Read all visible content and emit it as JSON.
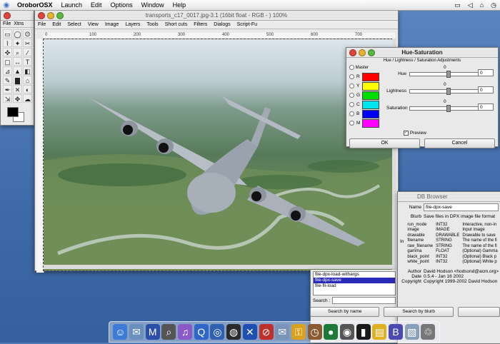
{
  "menubar": {
    "apple": "",
    "items": [
      "OroborOSX",
      "Launch",
      "Edit",
      "Options",
      "Window",
      "Help"
    ],
    "right": [
      "",
      "",
      "",
      ""
    ]
  },
  "toolbox": {
    "menu": [
      "File",
      "Xtns"
    ],
    "tools": [
      "▭",
      "◯",
      "ʘ",
      "⌇",
      "✦",
      "✂",
      "✜",
      "⌕",
      "∕",
      "▢",
      "↔",
      "T",
      "⊿",
      "▲",
      "◧",
      "✎",
      "▇",
      "⌂",
      "✒",
      "✕",
      "◐",
      "⇲",
      "✥",
      "☁"
    ]
  },
  "image_window": {
    "title": "transports_c17_0017.jpg-3.1 (16bit float - RGB - ) 100%",
    "menu": [
      "File",
      "Edit",
      "Select",
      "View",
      "Image",
      "Layers",
      "Tools",
      "Short cuts",
      "Filters",
      "Dialogs",
      "Script-Fu"
    ],
    "ruler_ticks": [
      "0",
      "100",
      "200",
      "300",
      "400",
      "500",
      "600",
      "700"
    ]
  },
  "hue_sat": {
    "title": "Hue-Saturation",
    "subtitle": "Hue / Lightness / Saturation Adjustments",
    "master": "Master",
    "swatches": [
      {
        "label": "R",
        "color": "#ff0000"
      },
      {
        "label": "Y",
        "color": "#ffff00"
      },
      {
        "label": "G",
        "color": "#00dd00"
      },
      {
        "label": "C",
        "color": "#00e5ee"
      },
      {
        "label": "B",
        "color": "#0000ee"
      },
      {
        "label": "M",
        "color": "#ff00ff"
      }
    ],
    "params": [
      {
        "name": "Hue",
        "zero": "0",
        "value": "0"
      },
      {
        "name": "Lightness",
        "zero": "0",
        "value": "0"
      },
      {
        "name": "Saturation",
        "zero": "0",
        "value": "0"
      }
    ],
    "preview": "Preview",
    "ok": "OK",
    "cancel": "Cancel"
  },
  "db_browser": {
    "title": "DB Browser",
    "name_label": "Name",
    "name_value": "file-dpx-save",
    "blurb_label": "Blurb",
    "blurb_value": "Save files in DPX image file format",
    "in_label": "In",
    "params": [
      [
        "run_mode",
        "INT32",
        "Interactive, non-in"
      ],
      [
        "image",
        "IMAGE",
        "Input image"
      ],
      [
        "drawable",
        "DRAWABLE",
        "Drawable to save"
      ],
      [
        "filename",
        "STRING",
        "The name of the fi"
      ],
      [
        "raw_filename",
        "STRING",
        "The name of the fi"
      ],
      [
        "gamma",
        "FLOAT",
        "(Optional) Gamma"
      ],
      [
        "black_point",
        "INT32",
        "(Optional) Black p"
      ],
      [
        "white_point",
        "INT32",
        "(Optional) White p"
      ]
    ],
    "author_label": "Author",
    "author_value": "David Hodson <hodsond@acm.org>",
    "date_label": "Date",
    "date_value": "0.5.4 - Jan 16 2002",
    "copyright_label": "Copyright",
    "copyright_value": "Copyright 1999-2002 David Hodson"
  },
  "proc_list": {
    "items": [
      "file-dpx-load-withargs",
      "file-dpx-save",
      "file-fli-load"
    ],
    "selected_index": 1,
    "search_label": "Search :",
    "search_by_name": "Search by name",
    "search_by_blurb": "Search by blurb"
  },
  "dock": {
    "icons": [
      "finder-icon",
      "mail-icon",
      "m-icon",
      "magnifier-icon",
      "itunes-icon",
      "quicktime-icon",
      "browser-icon",
      "globe-icon",
      "x11-icon",
      "stop-icon",
      "mail-stamp-icon",
      "lock-icon",
      "clock-icon",
      "ball-icon",
      "apple-icon",
      "terminal-icon",
      "folders-icon",
      "b-icon",
      "pictures-icon",
      "trash-icon"
    ]
  }
}
